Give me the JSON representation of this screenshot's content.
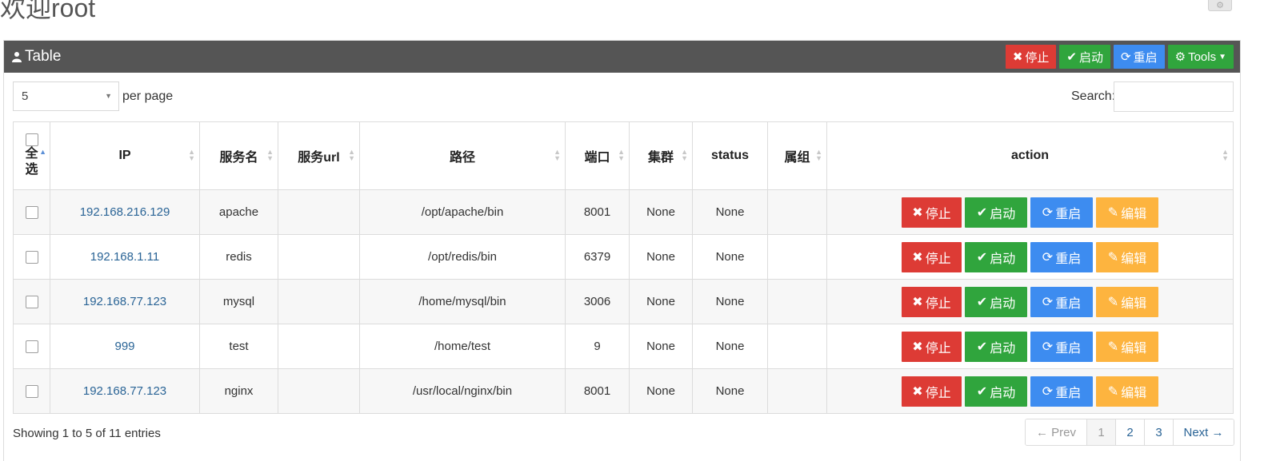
{
  "page": {
    "title": "欢迎root"
  },
  "panel": {
    "title": "Table",
    "tools": {
      "stop_label": "停止",
      "start_label": "启动",
      "restart_label": "重启",
      "tools_label": "Tools"
    }
  },
  "controls": {
    "page_size_value": "5",
    "per_page_label": "per page",
    "search_label": "Search:",
    "search_value": ""
  },
  "table": {
    "columns": {
      "select_all": "全选",
      "ip": "IP",
      "service": "服务名",
      "url": "服务url",
      "path": "路径",
      "port": "端口",
      "cluster": "集群",
      "status": "status",
      "group": "属组",
      "action": "action"
    },
    "action_labels": {
      "stop": "停止",
      "start": "启动",
      "restart": "重启",
      "edit": "编辑"
    },
    "rows": [
      {
        "ip": "192.168.216.129",
        "service": "apache",
        "url": "",
        "path": "/opt/apache/bin",
        "port": "8001",
        "cluster": "None",
        "status": "None",
        "group": ""
      },
      {
        "ip": "192.168.1.11",
        "service": "redis",
        "url": "",
        "path": "/opt/redis/bin",
        "port": "6379",
        "cluster": "None",
        "status": "None",
        "group": ""
      },
      {
        "ip": "192.168.77.123",
        "service": "mysql",
        "url": "",
        "path": "/home/mysql/bin",
        "port": "3006",
        "cluster": "None",
        "status": "None",
        "group": ""
      },
      {
        "ip": "999",
        "service": "test",
        "url": "",
        "path": "/home/test",
        "port": "9",
        "cluster": "None",
        "status": "None",
        "group": ""
      },
      {
        "ip": "192.168.77.123",
        "service": "nginx",
        "url": "",
        "path": "/usr/local/nginx/bin",
        "port": "8001",
        "cluster": "None",
        "status": "None",
        "group": ""
      }
    ]
  },
  "footer": {
    "info": "Showing 1 to 5 of 11 entries",
    "pagination": {
      "prev": "← Prev",
      "pages": [
        "1",
        "2",
        "3"
      ],
      "current": "1",
      "next": "Next →"
    }
  },
  "colors": {
    "header_bg": "#555555",
    "stop": "#dd3b35",
    "start": "#30a53d",
    "restart": "#3d8cf0",
    "edit": "#fdb43f",
    "link": "#2a6496"
  }
}
